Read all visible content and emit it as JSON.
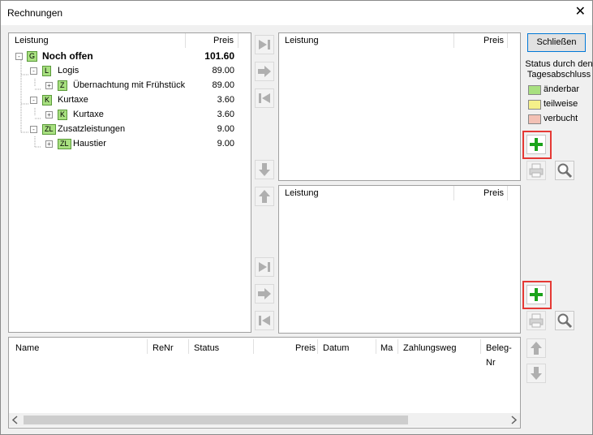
{
  "window": {
    "title": "Rechnungen",
    "close_glyph": "✕"
  },
  "tree_panel": {
    "header": {
      "leistung": "Leistung",
      "preis": "Preis"
    },
    "rows": [
      {
        "tag": "G",
        "label": "Noch offen",
        "price": "101.60",
        "bold": true
      },
      {
        "tag": "L",
        "label": "Logis",
        "price": "89.00"
      },
      {
        "tag": "Z",
        "label": "Übernachtung mit Frühstück",
        "price": "89.00"
      },
      {
        "tag": "K",
        "label": "Kurtaxe",
        "price": "3.60"
      },
      {
        "tag": "K",
        "label": "Kurtaxe",
        "price": "3.60"
      },
      {
        "tag": "ZL",
        "label": "Zusatzleistungen",
        "price": "9.00"
      },
      {
        "tag": "ZL",
        "label": "Haustier",
        "price": "9.00"
      }
    ],
    "expander_glyph": "-",
    "collapsed_glyph": "+"
  },
  "right_top_panel": {
    "header": {
      "leistung": "Leistung",
      "preis": "Preis"
    }
  },
  "right_bottom_panel": {
    "header": {
      "leistung": "Leistung",
      "preis": "Preis"
    }
  },
  "bottom_table": {
    "columns": [
      "Name",
      "ReNr",
      "Status",
      "Preis",
      "Datum",
      "Ma",
      "Zahlungsweg",
      "Beleg-Nr"
    ]
  },
  "side": {
    "close_button": "Schließen",
    "status_title": "Status durch den Tagesabschluss",
    "legend": [
      {
        "label": "änderbar",
        "color": "#a8e080"
      },
      {
        "label": "teilweise",
        "color": "#f5f08a"
      },
      {
        "label": "verbucht",
        "color": "#f3c1b5"
      }
    ]
  },
  "icons": {
    "move_last": "move-to-end-icon",
    "move_right": "arrow-right-icon",
    "move_first": "move-to-start-icon",
    "down": "arrow-down-icon",
    "up": "arrow-up-icon",
    "add": "plus-icon",
    "print": "printer-icon",
    "search": "magnifier-icon"
  },
  "colors": {
    "highlight": "#e53935",
    "plus_green": "#1aa31a"
  }
}
